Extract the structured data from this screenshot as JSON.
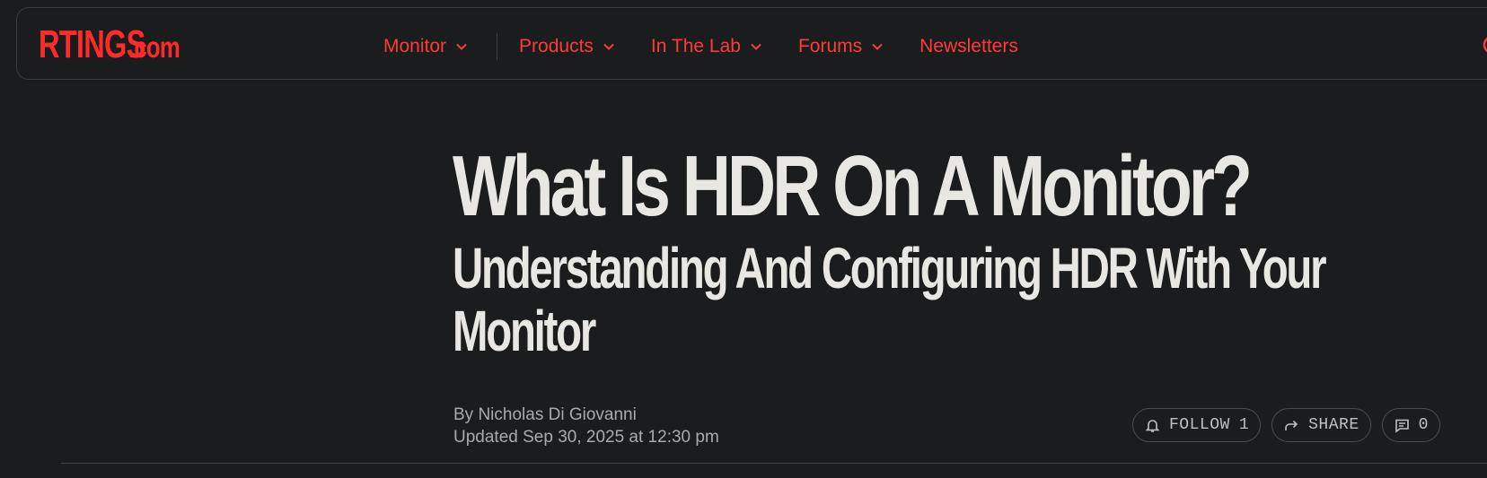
{
  "header": {
    "logo_main": "RTINGS",
    "logo_domain": ".com",
    "nav": [
      {
        "label": "Monitor",
        "has_chevron": true
      },
      {
        "label": "Products",
        "has_chevron": true
      },
      {
        "label": "In The Lab",
        "has_chevron": true
      },
      {
        "label": "Forums",
        "has_chevron": true
      },
      {
        "label": "Newsletters",
        "has_chevron": false
      }
    ],
    "accent_color": "#ff2b2b"
  },
  "article": {
    "title": "What Is HDR On A Monitor?",
    "subtitle": "Understanding And Configuring HDR With Your Monitor",
    "author": "By Nicholas Di Giovanni",
    "updated": "Updated Sep 30, 2025 at 12:30 pm"
  },
  "actions": {
    "follow_label": "FOLLOW",
    "follow_count": "1",
    "share_label": "SHARE",
    "comment_count": "0"
  },
  "icons": {
    "search": "search-icon",
    "bell": "bell-icon",
    "share": "share-arrow-icon",
    "comment": "comment-icon"
  }
}
